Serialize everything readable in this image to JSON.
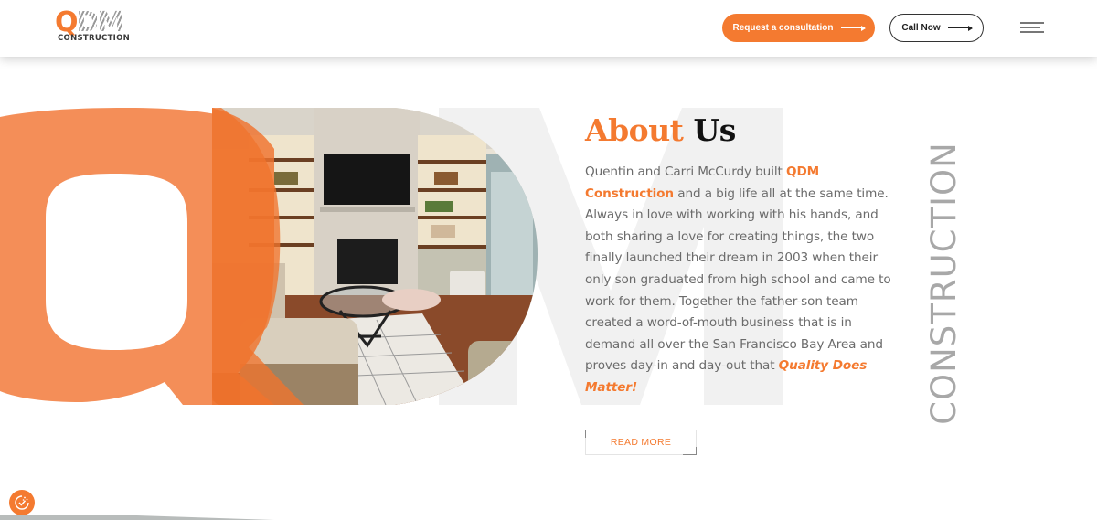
{
  "brand": {
    "logo_mark": "QDM",
    "logo_sub": "CONSTRUCTION",
    "accent_color": "#f47a30",
    "muted_text_color": "#6b6b6b"
  },
  "header": {
    "consult_button_label": "Request a consultation",
    "call_button_label": "Call Now",
    "menu_icon": "hamburger-menu-icon"
  },
  "hero": {
    "background_letters": [
      "Q",
      "M"
    ],
    "photo_alt": "Living room with fireplace, TV, and built-in shelves"
  },
  "about": {
    "title_part1": "About",
    "title_part2": "Us",
    "paragraph": {
      "p1": "Quentin and Carri McCurdy built ",
      "brand_name": "QDM Construction",
      "p2": " and a big life all at the same time. Always in love with working with his hands, and both sharing a love for creating things, the two finally launched their dream in 2003 when their only son graduated from high school and came to work for them. Together the father-son team created a word-of-mouth business that is in demand all over the San Francisco Bay Area and proves day-in and day-out that ",
      "tagline": "Quality Does Matter!"
    },
    "read_more_label": "READ MORE",
    "vertical_word": "CONSTRUCTION"
  },
  "floating": {
    "cookie_icon": "cookie-consent-icon"
  }
}
